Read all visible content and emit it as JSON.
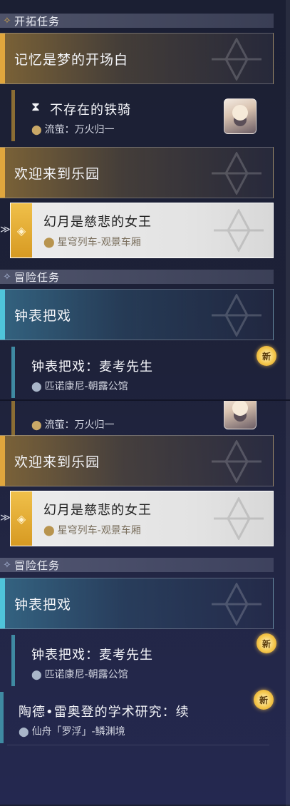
{
  "sections": {
    "trailblaze": "开拓任务",
    "adventure": "冒险任务"
  },
  "icons": {
    "trailblaze": "trailblaze-emblem-icon",
    "adventure": "adventure-emblem-icon",
    "pin": "location-pin-icon",
    "hourglass": "hourglass-icon"
  },
  "chapters": {
    "memory": "记忆是梦的开场白",
    "paradise": "欢迎来到乐园",
    "clock": "钟表把戏"
  },
  "quests": {
    "iron_knight": {
      "title": "不存在的铁骑",
      "location": "流萤：万火归一"
    },
    "illusion": {
      "title": "幻月是慈悲的女王",
      "location": "星穹列车-观景车厢"
    },
    "mcgoe": {
      "title": "钟表把戏：麦考先生",
      "location": "匹诺康尼-朝露公馆"
    },
    "idrila": {
      "title": "陶德•雷奥登的学术研究：续",
      "location": "仙舟「罗浮」-鳞渊境"
    }
  },
  "badge": {
    "new": "新"
  },
  "colors": {
    "gold": "#e0a63d",
    "cyan": "#4fc4da",
    "active_bg": "#ececec"
  }
}
